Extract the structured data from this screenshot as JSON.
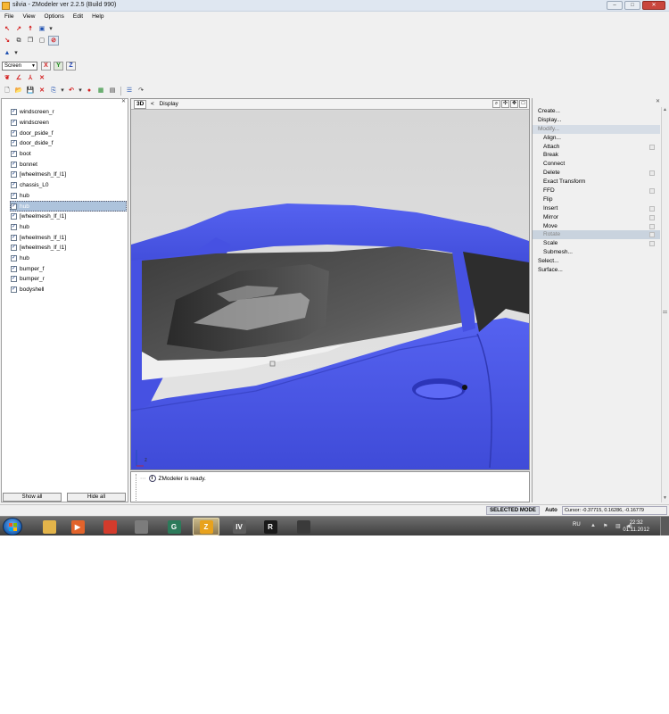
{
  "window": {
    "title": "silvia - ZModeler ver 2.2.5 (Build 990)",
    "buttons": {
      "minimize": "–",
      "maximize": "□",
      "close": "✕"
    }
  },
  "menu": [
    "File",
    "View",
    "Options",
    "Edit",
    "Help"
  ],
  "toolbar": {
    "screen_select": "Screen",
    "axes": [
      "X",
      "Y",
      "Z"
    ]
  },
  "objects": {
    "items": [
      "windscreen_r",
      "windscreen",
      "door_pside_f",
      "door_dside_f",
      "boot",
      "bonnet",
      "[wheelmesh_lf_l1]",
      "chassis_L0",
      "hub",
      "hub",
      "[wheelmesh_lf_l1]",
      "hub",
      "[wheelmesh_lf_l1]",
      "[wheelmesh_lf_l1]",
      "hub",
      "bumper_f",
      "bumper_r",
      "bodyshell"
    ],
    "selected_index": 9,
    "show_all": "Show all",
    "hide_all": "Hide all"
  },
  "viewport": {
    "mode": "3D",
    "back": "<",
    "display": "Display",
    "axis_indicator": "z"
  },
  "log": {
    "message": "ZModeler is ready."
  },
  "commands": [
    {
      "label": "Create...",
      "level": 0,
      "state": "normal",
      "options": false
    },
    {
      "label": "Display...",
      "level": 0,
      "state": "normal",
      "options": false
    },
    {
      "label": "Modify...",
      "level": 0,
      "state": "header",
      "options": false
    },
    {
      "label": "Align...",
      "level": 1,
      "state": "normal",
      "options": false
    },
    {
      "label": "Attach",
      "level": 1,
      "state": "normal",
      "options": true
    },
    {
      "label": "Break",
      "level": 1,
      "state": "normal",
      "options": false
    },
    {
      "label": "Connect",
      "level": 1,
      "state": "normal",
      "options": false
    },
    {
      "label": "Delete",
      "level": 1,
      "state": "normal",
      "options": true
    },
    {
      "label": "Exact Transform",
      "level": 1,
      "state": "normal",
      "options": false
    },
    {
      "label": "FFD",
      "level": 1,
      "state": "normal",
      "options": true
    },
    {
      "label": "Flip",
      "level": 1,
      "state": "normal",
      "options": false
    },
    {
      "label": "Insert",
      "level": 1,
      "state": "normal",
      "options": true
    },
    {
      "label": "Mirror",
      "level": 1,
      "state": "normal",
      "options": true
    },
    {
      "label": "Move",
      "level": 1,
      "state": "normal",
      "options": true
    },
    {
      "label": "Rotate",
      "level": 1,
      "state": "active",
      "options": true
    },
    {
      "label": "Scale",
      "level": 1,
      "state": "normal",
      "options": true
    },
    {
      "label": "Submesh...",
      "level": 1,
      "state": "normal",
      "options": false
    },
    {
      "label": "Select...",
      "level": 0,
      "state": "normal",
      "options": false
    },
    {
      "label": "Surface...",
      "level": 0,
      "state": "normal",
      "options": false
    }
  ],
  "status": {
    "mode": "SELECTED MODE",
    "auto": "Auto",
    "cursor": "Cursor: -0.37715, 0.16286, -0.16779"
  },
  "taskbar": {
    "apps": [
      {
        "name": "explorer-icon",
        "glyph": "",
        "color": "#e3b44a"
      },
      {
        "name": "media-player-icon",
        "glyph": "▶",
        "color": "#e2632b"
      },
      {
        "name": "chrome-icon",
        "glyph": "",
        "color": "#d33b2c"
      },
      {
        "name": "total-commander-icon",
        "glyph": "",
        "color": "#7c7c7c"
      },
      {
        "name": "g-app-icon",
        "glyph": "G",
        "color": "#2c7a5a"
      },
      {
        "name": "zmodeler-icon",
        "glyph": "Z",
        "color": "#e8a21c"
      },
      {
        "name": "openiv-icon",
        "glyph": "IV",
        "color": "#5d5d5d"
      },
      {
        "name": "rockstar-icon",
        "glyph": "R",
        "color": "#1a1a1a"
      },
      {
        "name": "game-icon",
        "glyph": "",
        "color": "#3a3a3a"
      }
    ],
    "active_index": 5,
    "lang": "RU",
    "time": "22:32",
    "date": "01.11.2012"
  },
  "colors": {
    "car_body": "#4a55e8",
    "selection": "#adc3dc",
    "taskbar": "#4a4a4a"
  }
}
